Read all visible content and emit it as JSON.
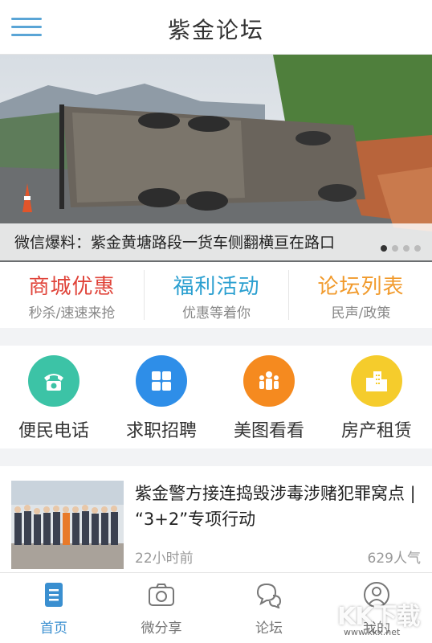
{
  "header": {
    "title": "紫金论坛",
    "menu_icon": "hamburger-menu-icon"
  },
  "banner": {
    "caption": "微信爆料：紫金黄塘路段一货车侧翻横亘在路口",
    "slide_count": 4,
    "active_slide": 1
  },
  "promos": [
    {
      "title": "商城优惠",
      "subtitle": "秒杀/速速来抢",
      "color": "#e0443a"
    },
    {
      "title": "福利活动",
      "subtitle": "优惠等着你",
      "color": "#2a9fd0"
    },
    {
      "title": "论坛列表",
      "subtitle": "民声/政策",
      "color": "#f19a2c"
    }
  ],
  "services": [
    {
      "label": "便民电话",
      "icon": "phone-icon",
      "color": "#3cc3a6"
    },
    {
      "label": "求职招聘",
      "icon": "grid-icon",
      "color": "#2e8ee8"
    },
    {
      "label": "美图看看",
      "icon": "people-icon",
      "color": "#f58a1f"
    },
    {
      "label": "房产租赁",
      "icon": "building-icon",
      "color": "#f5cc2c"
    }
  ],
  "news": {
    "title": "紫金警方接连捣毁涉毒涉赌犯罪窝点 | “3+2”专项行动",
    "time": "22小时前",
    "popularity": "629人气"
  },
  "tabs": [
    {
      "label": "首页",
      "icon": "home-doc-icon",
      "active": true
    },
    {
      "label": "微分享",
      "icon": "camera-icon",
      "active": false
    },
    {
      "label": "论坛",
      "icon": "chat-bubbles-icon",
      "active": false
    },
    {
      "label": "我的",
      "icon": "user-icon",
      "active": false
    }
  ],
  "watermark": {
    "logo": "KK下载",
    "url": "www.kkx.net"
  },
  "colors": {
    "accent": "#3a8fd0",
    "menu": "#5aa5d6"
  }
}
